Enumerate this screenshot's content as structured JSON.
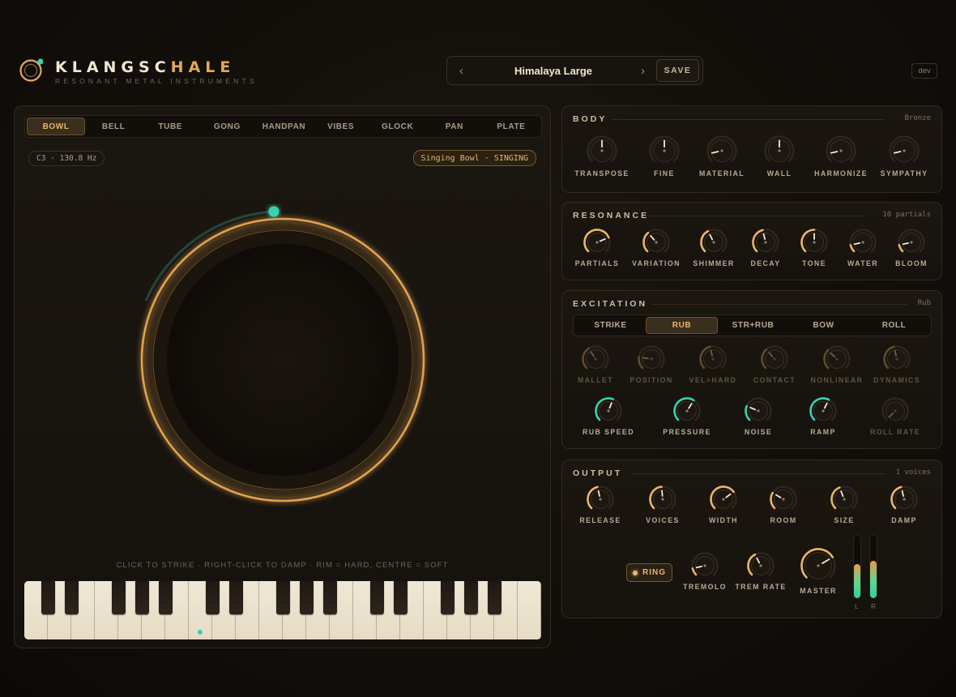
{
  "header": {
    "brand_main": "KLANGSC",
    "brand_accent": "HALE",
    "subtitle": "RESONANT METAL INSTRUMENTS",
    "preset_name": "Himalaya Large",
    "prev_arrow": "‹",
    "next_arrow": "›",
    "save_label": "SAVE",
    "dev_label": "dev"
  },
  "instrument_tabs": [
    {
      "label": "BOWL",
      "active": true
    },
    {
      "label": "BELL",
      "active": false
    },
    {
      "label": "TUBE",
      "active": false
    },
    {
      "label": "GONG",
      "active": false
    },
    {
      "label": "HANDPAN",
      "active": false
    },
    {
      "label": "VIBES",
      "active": false
    },
    {
      "label": "GLOCK",
      "active": false
    },
    {
      "label": "PAN",
      "active": false
    },
    {
      "label": "PLATE",
      "active": false
    }
  ],
  "instrument": {
    "note": "C3 · 130.8 Hz",
    "mode": "Singing Bowl · SINGING",
    "hint": "CLICK TO STRIKE · RIGHT-CLICK TO DAMP · RIM = HARD, CENTRE = SOFT"
  },
  "body_section": {
    "title": "BODY",
    "tag": "Bronze",
    "knobs": [
      {
        "label": "TRANSPOSE",
        "value": 0.5
      },
      {
        "label": "FINE",
        "value": 0.5
      },
      {
        "label": "MATERIAL",
        "value": 0.12
      },
      {
        "label": "WALL",
        "value": 0.5
      },
      {
        "label": "HARMONIZE",
        "value": 0.12
      },
      {
        "label": "SYMPATHY",
        "value": 0.12
      }
    ]
  },
  "resonance_section": {
    "title": "RESONANCE",
    "tag": "10 partials",
    "knobs": [
      {
        "label": "PARTIALS",
        "value": 0.75
      },
      {
        "label": "VARIATION",
        "value": 0.35
      },
      {
        "label": "SHIMMER",
        "value": 0.4
      },
      {
        "label": "DECAY",
        "value": 0.45
      },
      {
        "label": "TONE",
        "value": 0.5
      },
      {
        "label": "WATER",
        "value": 0.12
      },
      {
        "label": "BLOOM",
        "value": 0.12
      }
    ]
  },
  "excitation_section": {
    "title": "EXCITATION",
    "tag": "Rub",
    "modes": [
      {
        "label": "STRIKE",
        "active": false
      },
      {
        "label": "RUB",
        "active": true
      },
      {
        "label": "STR+RUB",
        "active": false
      },
      {
        "label": "BOW",
        "active": false
      },
      {
        "label": "ROLL",
        "active": false
      }
    ],
    "dim_knobs": [
      {
        "label": "MALLET",
        "value": 0.38
      },
      {
        "label": "POSITION",
        "value": 0.2
      },
      {
        "label": "VEL>HARD",
        "value": 0.45
      },
      {
        "label": "CONTACT",
        "value": 0.35
      },
      {
        "label": "NONLINEAR",
        "value": 0.33
      },
      {
        "label": "DYNAMICS",
        "value": 0.45
      }
    ],
    "active_knobs": [
      {
        "label": "RUB SPEED",
        "value": 0.58
      },
      {
        "label": "PRESSURE",
        "value": 0.62
      },
      {
        "label": "NOISE",
        "value": 0.25
      },
      {
        "label": "RAMP",
        "value": 0.6
      },
      {
        "label": "ROLL RATE",
        "value": 0.0,
        "dim": true
      }
    ]
  },
  "output_section": {
    "title": "OUTPUT",
    "tag": "1 voices",
    "knobs": [
      {
        "label": "RELEASE",
        "value": 0.45
      },
      {
        "label": "VOICES",
        "value": 0.48
      },
      {
        "label": "WIDTH",
        "value": 0.7
      },
      {
        "label": "ROOM",
        "value": 0.28
      },
      {
        "label": "SIZE",
        "value": 0.42
      },
      {
        "label": "DAMP",
        "value": 0.45
      }
    ],
    "ring_label": "RING",
    "lower_knobs": [
      {
        "label": "TREMOLO",
        "value": 0.12
      },
      {
        "label": "TREM RATE",
        "value": 0.4
      },
      {
        "label": "MASTER",
        "value": 0.72
      }
    ],
    "meter_left_label": "L",
    "meter_right_label": "R",
    "meter_left_level": 0.55,
    "meter_right_level": 0.6
  },
  "colors": {
    "accent": "#e9b56a",
    "teal": "#3ad0b0",
    "track": "#2e261d",
    "dim_accent": "#5e4a2c",
    "dim_teal": "#1f4a40"
  }
}
